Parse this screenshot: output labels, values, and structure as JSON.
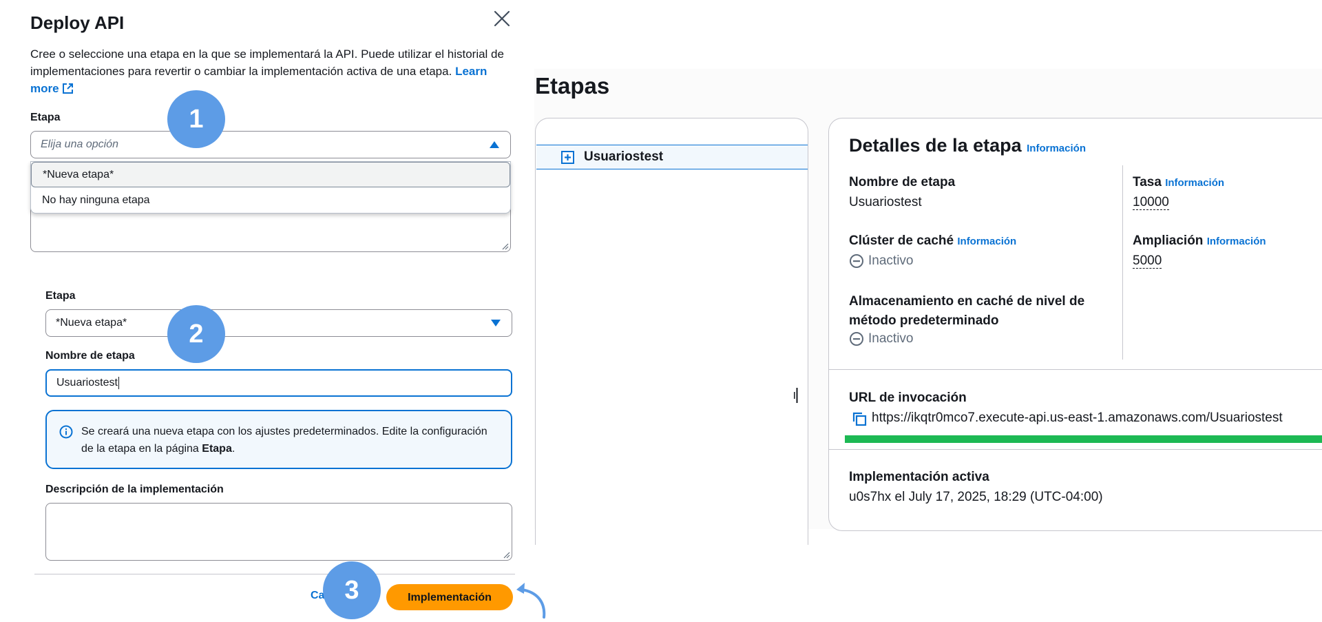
{
  "modal": {
    "title": "Deploy API",
    "description": "Cree o seleccione una etapa en la que se implementará la API. Puede utilizar el historial de implementaciones para revertir o cambiar la implementación activa de una etapa.",
    "learn_more": "Learn more",
    "stage_label_1": "Etapa",
    "stage_placeholder": "Elija una opción",
    "dropdown_options": [
      "*Nueva etapa*",
      "No hay ninguna etapa"
    ],
    "stage_label_2": "Etapa",
    "stage_selected": "*Nueva etapa*",
    "stage_name_label": "Nombre de etapa",
    "stage_name_value": "Usuariostest",
    "alert_text_1": "Se creará una nueva etapa con los ajustes predeterminados. Edite la configuración de la etapa en la página ",
    "alert_text_bold": "Etapa",
    "alert_text_2": ".",
    "deploy_desc_label": "Descripción de la implementación",
    "cancel_label": "Ca",
    "deploy_button": "Implementación"
  },
  "steps": [
    "1",
    "2",
    "3"
  ],
  "stages": {
    "page_title": "Etapas",
    "tree_item": "Usuariostest",
    "details_title": "Detalles de la etapa",
    "info_link": "Información",
    "stage_name_label": "Nombre de etapa",
    "stage_name_value": "Usuariostest",
    "rate_label": "Tasa",
    "rate_value": "10000",
    "cache_cluster_label": "Clúster de caché",
    "cache_cluster_value": "Inactivo",
    "burst_label": "Ampliación",
    "burst_value": "5000",
    "method_cache_label": "Almacenamiento en caché de nivel de método predeterminado",
    "method_cache_value": "Inactivo",
    "invoke_url_label": "URL de invocación",
    "invoke_url": "https://ikqtr0mco7.execute-api.us-east-1.amazonaws.com/Usuariostest",
    "active_deploy_label": "Implementación activa",
    "active_deploy_value": "u0s7hx el July 17, 2025, 18:29 (UTC-04:00)"
  },
  "colors": {
    "accent": "#0972d3",
    "primary_button": "#ff9900",
    "step_badge": "#5d9ce6",
    "highlight_bar": "#1db954"
  }
}
